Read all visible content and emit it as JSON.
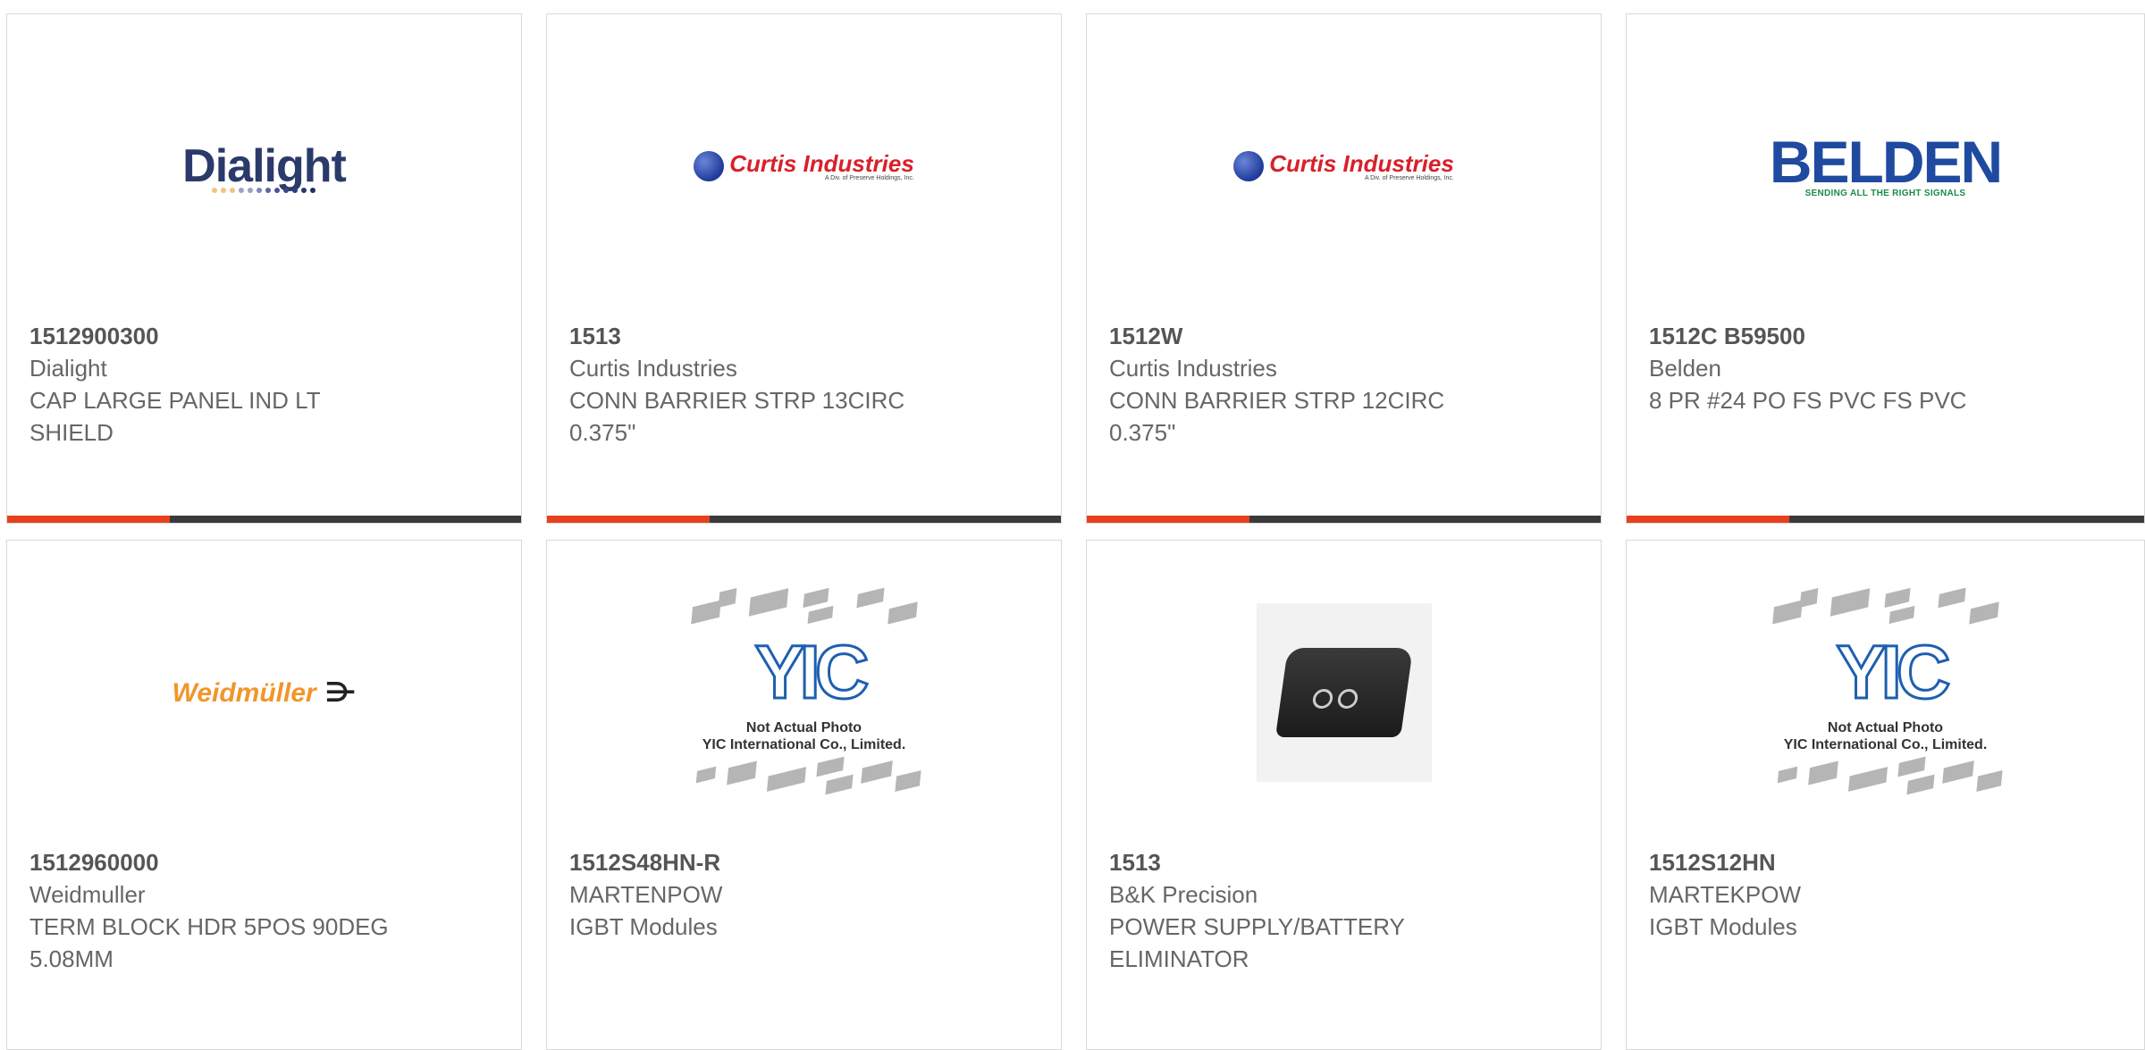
{
  "products": [
    {
      "part_number": "1512900300",
      "manufacturer": "Dialight",
      "description": "CAP LARGE PANEL IND LT SHIELD",
      "logo": "dialight-logo"
    },
    {
      "part_number": "1513",
      "manufacturer": "Curtis Industries",
      "description": "CONN BARRIER STRP 13CIRC 0.375\"",
      "logo": "curtis-logo"
    },
    {
      "part_number": "1512W",
      "manufacturer": "Curtis Industries",
      "description": "CONN BARRIER STRP 12CIRC 0.375\"",
      "logo": "curtis-logo"
    },
    {
      "part_number": "1512C B59500",
      "manufacturer": "Belden",
      "description": "8 PR #24 PO FS PVC FS PVC",
      "logo": "belden-logo"
    },
    {
      "part_number": "1512960000",
      "manufacturer": "Weidmuller",
      "description": "TERM BLOCK HDR 5POS 90DEG 5.08MM",
      "logo": "weidmuller-logo"
    },
    {
      "part_number": "1512S48HN-R",
      "manufacturer": "MARTENPOW",
      "description": "IGBT Modules",
      "logo": "yic-placeholder"
    },
    {
      "part_number": "1513",
      "manufacturer": "B&K Precision",
      "description": "POWER SUPPLY/BATTERY ELIMINATOR",
      "logo": "power-supply-photo"
    },
    {
      "part_number": "1512S12HN",
      "manufacturer": "MARTEKPOW",
      "description": "IGBT Modules",
      "logo": "yic-placeholder"
    }
  ],
  "logos": {
    "dialight": "Dialight",
    "curtis": {
      "name": "Curtis Industries",
      "sub": "A Div. of Preserve Holdings, Inc."
    },
    "belden": {
      "name": "BELDEN",
      "tag": "SENDING ALL THE RIGHT SIGNALS"
    },
    "weidmuller": "Weidmüller"
  },
  "placeholder": {
    "logo_text": "YIC",
    "caption_line1": "Not Actual Photo",
    "caption_line2": "YIC International Co., Limited."
  },
  "colors": {
    "accent": "#e8401c",
    "bar_dark": "#3a3a3a",
    "border": "#d9d9d9",
    "text_bold": "#555555",
    "text": "#666666"
  }
}
